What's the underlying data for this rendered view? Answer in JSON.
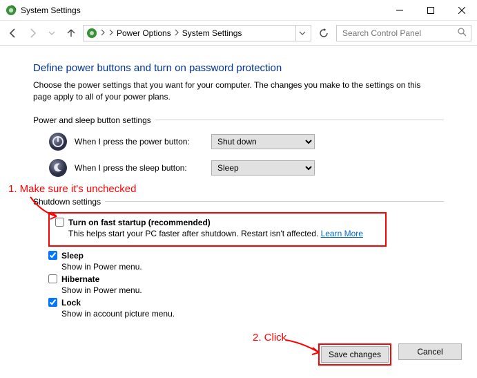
{
  "window": {
    "title": "System Settings"
  },
  "breadcrumb": {
    "item1": "Power Options",
    "item2": "System Settings"
  },
  "search": {
    "placeholder": "Search Control Panel"
  },
  "page": {
    "title": "Define power buttons and turn on password protection",
    "description": "Choose the power settings that you want for your computer. The changes you make to the settings on this page apply to all of your power plans."
  },
  "sections": {
    "power_sleep": {
      "header": "Power and sleep button settings",
      "power_label": "When I press the power button:",
      "power_value": "Shut down",
      "sleep_label": "When I press the sleep button:",
      "sleep_value": "Sleep"
    },
    "shutdown": {
      "header": "Shutdown settings",
      "fast_startup": {
        "title": "Turn on fast startup (recommended)",
        "desc": "This helps start your PC faster after shutdown. Restart isn't affected. ",
        "learn_more": "Learn More",
        "checked": false
      },
      "sleep": {
        "title": "Sleep",
        "desc": "Show in Power menu.",
        "checked": true
      },
      "hibernate": {
        "title": "Hibernate",
        "desc": "Show in Power menu.",
        "checked": false
      },
      "lock": {
        "title": "Lock",
        "desc": "Show in account picture menu.",
        "checked": true
      }
    }
  },
  "buttons": {
    "save": "Save changes",
    "cancel": "Cancel"
  },
  "annotations": {
    "step1": "1. Make sure it's unchecked",
    "step2": "2. Click"
  }
}
